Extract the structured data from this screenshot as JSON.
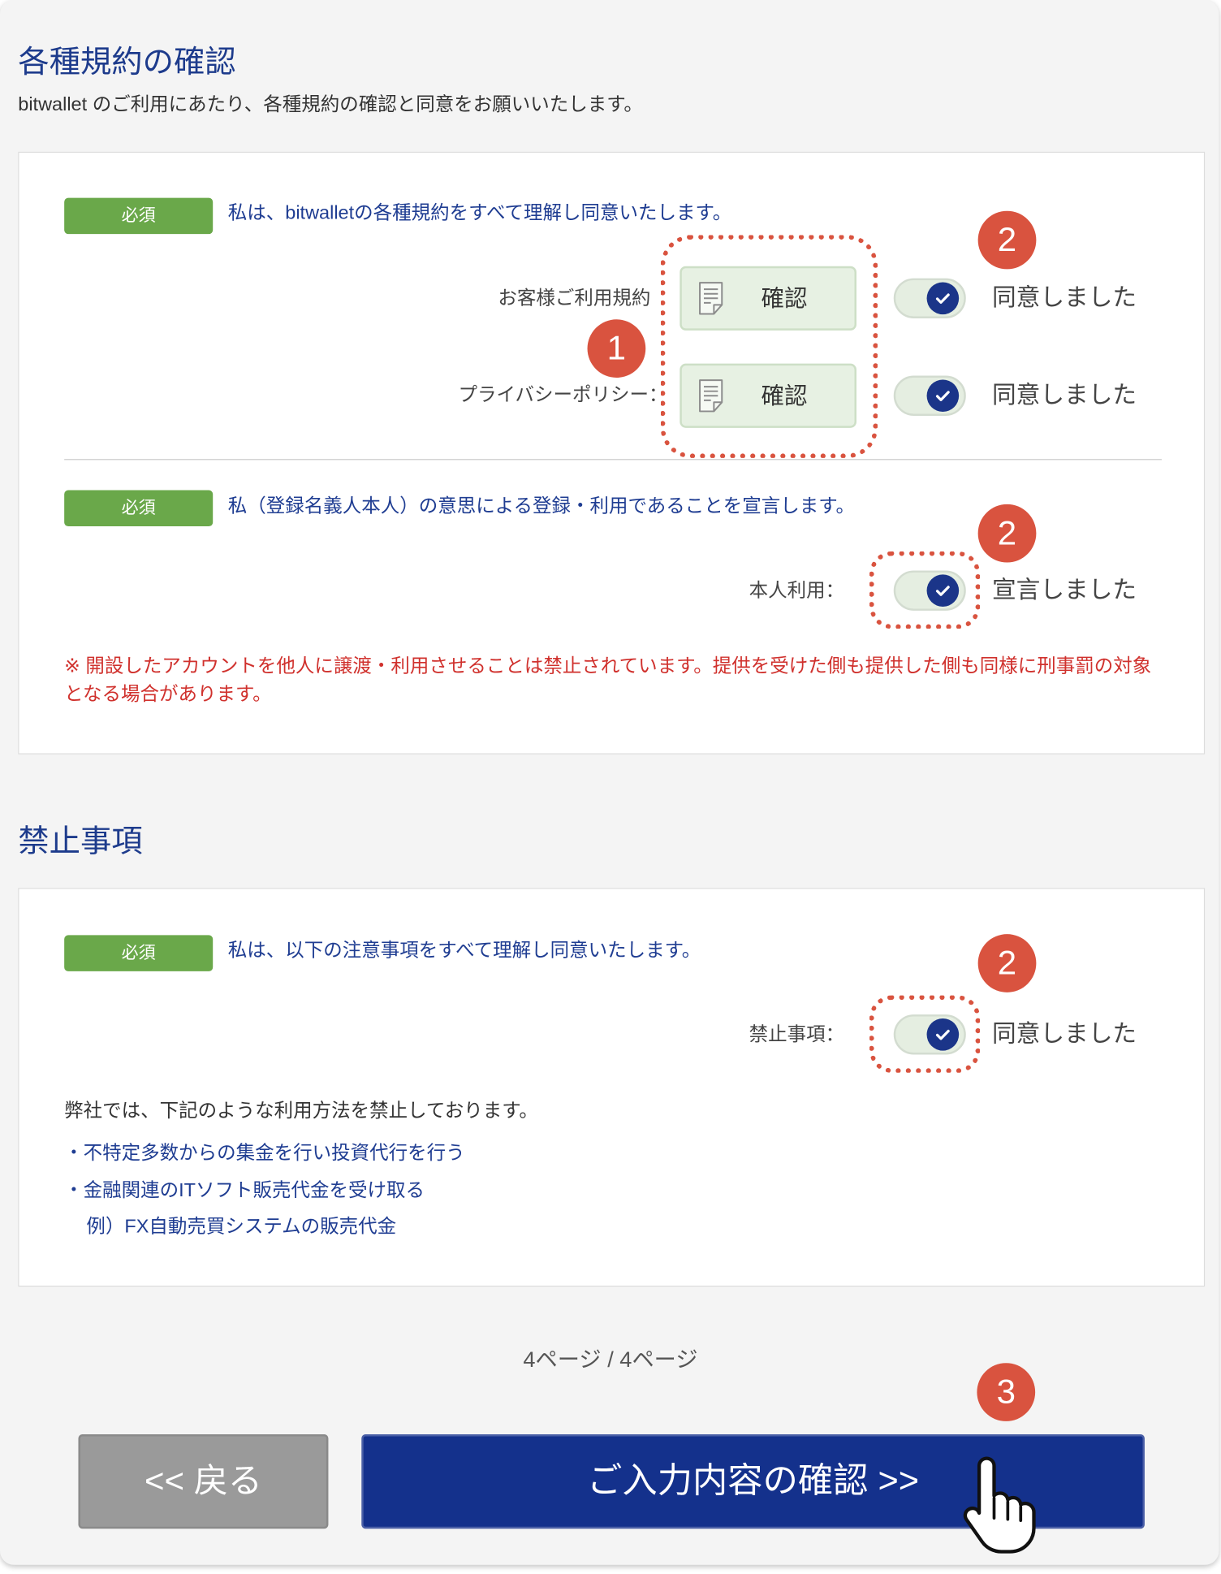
{
  "terms_section": {
    "title": "各種規約の確認",
    "description": "bitwallet のご利用にあたり、各種規約の確認と同意をお願いいたします。",
    "agreement": {
      "badge": "必須",
      "statement": "私は、bitwalletの各種規約をすべて理解し同意いたします。",
      "items": [
        {
          "label": "お客様ご利用規約",
          "button": "確認",
          "agreed": true,
          "status": "同意しました"
        },
        {
          "label": "プライバシーポリシー：",
          "button": "確認",
          "agreed": true,
          "status": "同意しました"
        }
      ]
    },
    "declaration": {
      "badge": "必須",
      "statement": "私（登録名義人本人）の意思による登録・利用であることを宣言します。",
      "label": "本人利用：",
      "agreed": true,
      "status": "宣言しました",
      "warning": "※ 開設したアカウントを他人に譲渡・利用させることは禁止されています。提供を受けた側も提供した側も同様に刑事罰の対象となる場合があります。"
    }
  },
  "prohibited_section": {
    "title": "禁止事項",
    "badge": "必須",
    "statement": "私は、以下の注意事項をすべて理解し同意いたします。",
    "label": "禁止事項：",
    "agreed": true,
    "status": "同意しました",
    "notice": "弊社では、下記のような利用方法を禁止しております。",
    "list": [
      "・不特定多数からの集金を行い投資代行を行う",
      "・金融関連のITソフト販売代金を受け取る"
    ],
    "example": "例）FX自動売買システムの販売代金"
  },
  "pagination": "4ページ / 4ページ",
  "footer": {
    "back_label": "<< 戻る",
    "submit_label": "ご入力内容の確認 >>"
  },
  "annotations": {
    "confirm_buttons": "1",
    "toggles": "2",
    "submit": "3"
  },
  "icons": {
    "document": "document-icon",
    "check": "check-icon",
    "cursor": "pointer-hand-icon"
  },
  "colors": {
    "title": "#1d3b8c",
    "link_text": "#1f3d92",
    "badge": "#6aa84a",
    "toggle_knob": "#1b3589",
    "annotation": "#d9533f",
    "warning": "#d0312d",
    "back_button": "#9a9a9a",
    "submit_button": "#14318c"
  }
}
